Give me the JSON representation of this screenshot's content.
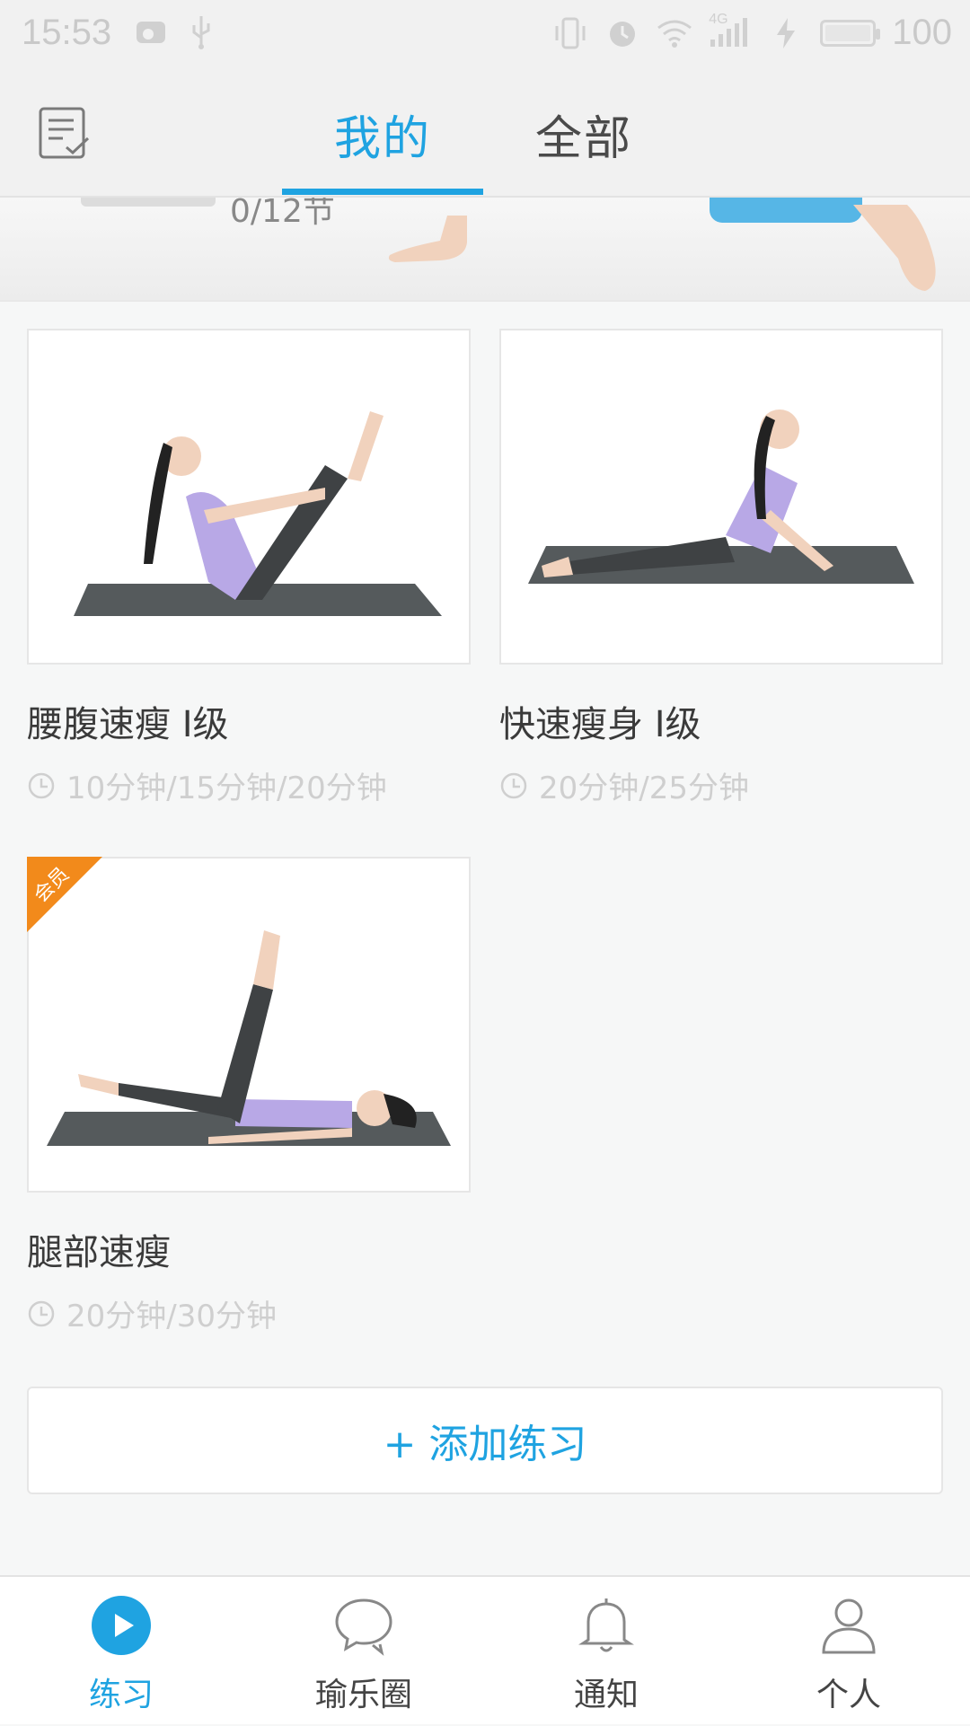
{
  "status_bar": {
    "time": "15:53",
    "network_label": "4G",
    "battery": "100"
  },
  "top_nav": {
    "tabs": [
      {
        "label": "我的",
        "active": true
      },
      {
        "label": "全部",
        "active": false
      }
    ]
  },
  "banner": {
    "progress_text": "0/12节"
  },
  "courses": [
    {
      "title": "腰腹速瘦 I级",
      "duration": "10分钟/15分钟/20分钟",
      "vip": false
    },
    {
      "title": "快速瘦身 I级",
      "duration": "20分钟/25分钟",
      "vip": false
    },
    {
      "title": "腿部速瘦",
      "duration": "20分钟/30分钟",
      "vip": true,
      "badge": "会员"
    }
  ],
  "add_button": {
    "label": "+ 添加练习"
  },
  "bottom_nav": {
    "items": [
      {
        "label": "练习",
        "icon": "play-icon",
        "active": true
      },
      {
        "label": "瑜乐圈",
        "icon": "chat-icon",
        "active": false
      },
      {
        "label": "通知",
        "icon": "bell-icon",
        "active": false
      },
      {
        "label": "个人",
        "icon": "person-icon",
        "active": false
      }
    ]
  },
  "colors": {
    "accent": "#1fa3e1",
    "vip": "#f28a1b",
    "background": "#f6f7f7"
  }
}
